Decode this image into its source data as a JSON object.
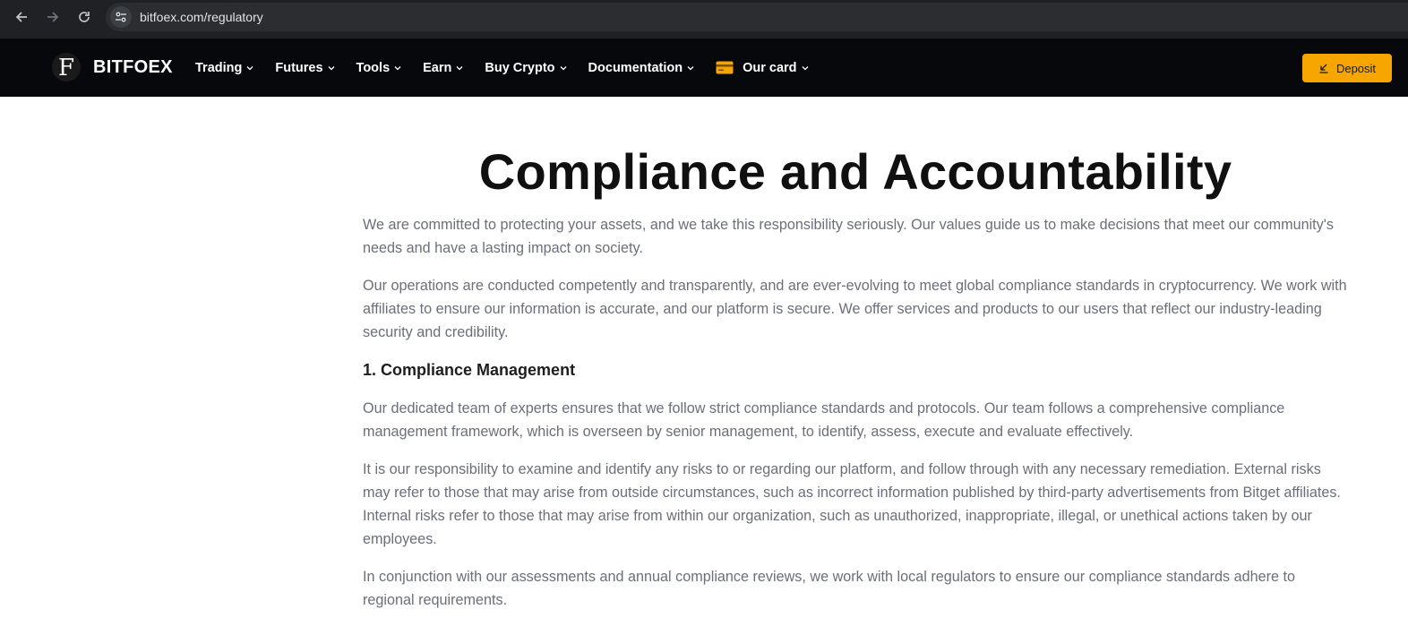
{
  "browser": {
    "url": "bitfoex.com/regulatory"
  },
  "header": {
    "logo_letter": "F",
    "brand": "BITFOEX",
    "menu": [
      {
        "label": "Trading"
      },
      {
        "label": "Futures"
      },
      {
        "label": "Tools"
      },
      {
        "label": "Earn"
      },
      {
        "label": "Buy Crypto"
      },
      {
        "label": "Documentation"
      },
      {
        "label": "Our card"
      }
    ],
    "deposit_label": "Deposit",
    "accent_color": "#f7a600"
  },
  "main": {
    "title": "Compliance and Accountability",
    "intro_1": "We are committed to protecting your assets, and we take this responsibility seriously. Our values guide us to make decisions that meet our community's needs and have a lasting impact on society.",
    "intro_2": "Our operations are conducted competently and transparently, and are ever-evolving to meet global compliance standards in cryptocurrency. We work with affiliates to ensure our information is accurate, and our platform is secure. We offer services and products to our users that reflect our industry-leading security and credibility.",
    "section_1_heading": "1. Compliance Management",
    "section_1_p1": "Our dedicated team of experts ensures that we follow strict compliance standards and protocols. Our team follows a comprehensive compliance management framework, which is overseen by senior management, to identify, assess, execute and evaluate effectively.",
    "section_1_p2": "It is our responsibility to examine and identify any risks to or regarding our platform, and follow through with any necessary remediation. External risks may refer to those that may arise from outside circumstances, such as incorrect information published by third-party advertisements from Bitget affiliates. Internal risks refer to those that may arise from within our organization, such as unauthorized, inappropriate, illegal, or unethical actions taken by our employees.",
    "section_1_p3": "In conjunction with our assessments and annual compliance reviews, we work with local regulators to ensure our compliance standards adhere to regional requirements."
  }
}
